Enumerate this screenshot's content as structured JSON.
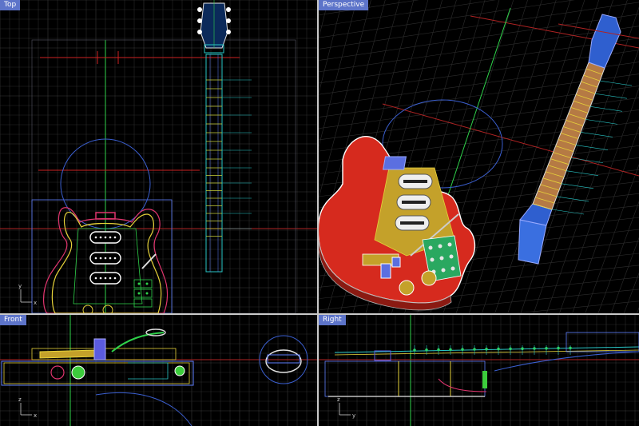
{
  "viewports": {
    "top": {
      "label": "Top"
    },
    "perspective": {
      "label": "Perspective"
    },
    "front": {
      "label": "Front"
    },
    "right": {
      "label": "Right"
    }
  },
  "colors": {
    "background": "#000000",
    "grid": "#2b2b2b",
    "grid_major": "#3a3a3a",
    "label_bg": "#5d74c9",
    "divider": "#c8c8c8",
    "guitar_body": "#d62a1e",
    "fretboard": "#b57a44",
    "neck_blue": "#3a6fe0"
  },
  "icons": [
    "axis-gizmo-icon"
  ]
}
